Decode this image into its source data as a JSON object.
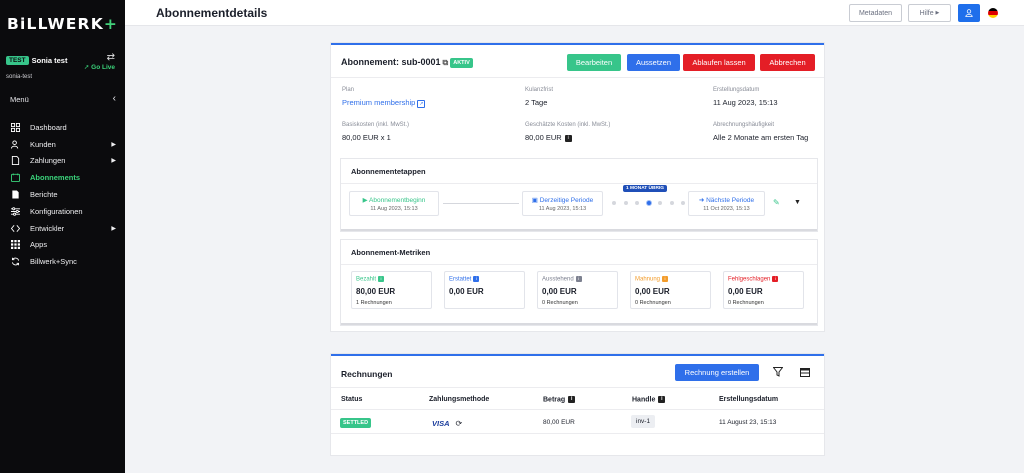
{
  "brand": {
    "logo_main": "BiLLWERK",
    "logo_plus": "+"
  },
  "account": {
    "badge": "TEST",
    "name": "Sonia test",
    "id": "sonia-test",
    "go_live": "Go Live"
  },
  "sidebar": {
    "menu_label": "Menü",
    "items": [
      {
        "label": "Dashboard",
        "icon": "dashboard-icon"
      },
      {
        "label": "Kunden",
        "icon": "users-icon"
      },
      {
        "label": "Zahlungen",
        "icon": "document-icon"
      },
      {
        "label": "Abonnements",
        "icon": "subscription-icon"
      },
      {
        "label": "Berichte",
        "icon": "report-icon"
      },
      {
        "label": "Konfigurationen",
        "icon": "sliders-icon"
      },
      {
        "label": "Entwickler",
        "icon": "code-icon"
      },
      {
        "label": "Apps",
        "icon": "apps-icon"
      },
      {
        "label": "Billwerk+Sync",
        "icon": "sync-icon"
      }
    ]
  },
  "header": {
    "title": "Abonnementdetails",
    "metadata_label": "Metadaten",
    "help_label": "Hilfe"
  },
  "subscription": {
    "title": "Abonnement: sub-0001",
    "status": "AKTIV",
    "actions": {
      "edit": "Bearbeiten",
      "pause": "Aussetzen",
      "expire": "Ablaufen lassen",
      "cancel": "Abbrechen"
    },
    "fields": {
      "plan_label": "Plan",
      "plan_value": "Premium membership",
      "grace_label": "Kulanzfrist",
      "grace_value": "2 Tage",
      "created_label": "Erstellungsdatum",
      "created_value": "11 Aug 2023, 15:13",
      "base_label": "Basiskosten (inkl. MwSt.)",
      "base_value": "80,00 EUR x 1",
      "estimated_label": "Geschätzte Kosten (inkl. MwSt.)",
      "estimated_value": "80,00 EUR",
      "freq_label": "Abrechnungshäufigkeit",
      "freq_value": "Alle 2 Monate am ersten Tag"
    }
  },
  "stages": {
    "title": "Abonnementetappen",
    "start": {
      "label": "Abonnementbeginn",
      "date": "11 Aug 2023, 15:13"
    },
    "current": {
      "label": "Derzeitige Periode",
      "date": "11 Aug 2023, 15:13"
    },
    "next": {
      "label": "Nächste Periode",
      "date": "11 Oct 2023, 15:13"
    },
    "remaining": "1 MONAT ÜBRIG",
    "progress_fraction": 0.5
  },
  "metrics": {
    "title": "Abonnement-Metriken",
    "items": [
      {
        "label": "Bezahlt",
        "value": "80,00 EUR",
        "sub": "1 Rechnungen",
        "color": "#37c58a"
      },
      {
        "label": "Erstattet",
        "value": "0,00 EUR",
        "sub": "",
        "color": "#2f6fea"
      },
      {
        "label": "Ausstehend",
        "value": "0,00 EUR",
        "sub": "0 Rechnungen",
        "color": "#7d8190"
      },
      {
        "label": "Mahnung",
        "value": "0,00 EUR",
        "sub": "0 Rechnungen",
        "color": "#f39c2b"
      },
      {
        "label": "Fehlgeschlagen",
        "value": "0,00 EUR",
        "sub": "0 Rechnungen",
        "color": "#e41e26"
      }
    ]
  },
  "invoices": {
    "title": "Rechnungen",
    "create_label": "Rechnung erstellen",
    "columns": {
      "status": "Status",
      "method": "Zahlungsmethode",
      "amount": "Betrag",
      "handle": "Handle",
      "created": "Erstellungsdatum"
    },
    "rows": [
      {
        "status": "SETTLED",
        "method": "VISA",
        "amount": "80,00 EUR",
        "handle": "inv-1",
        "created": "11 August 23, 15:13"
      }
    ]
  },
  "colors": {
    "accent": "#2f6fea",
    "success": "#37c58a",
    "danger": "#e41e26",
    "sidebar": "#0b0b0d"
  }
}
